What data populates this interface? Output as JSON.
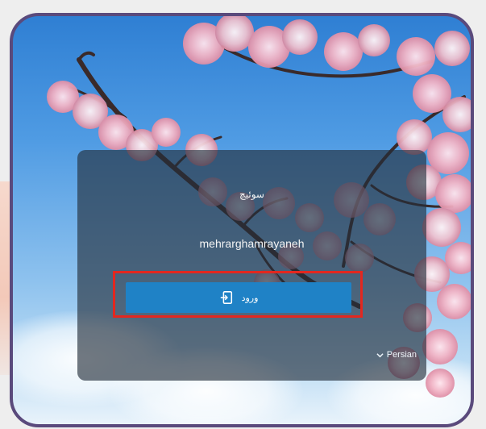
{
  "login": {
    "user_label": "سوئیچ",
    "username": "mehrarghamrayaneh",
    "button_label": "ورود",
    "button_icon": "sign-in-icon"
  },
  "language": {
    "selected": "Persian",
    "icon": "chevron-down-icon"
  },
  "colors": {
    "frame": "#5a4a7c",
    "button": "#1f82c6",
    "highlight": "#e3271f"
  }
}
